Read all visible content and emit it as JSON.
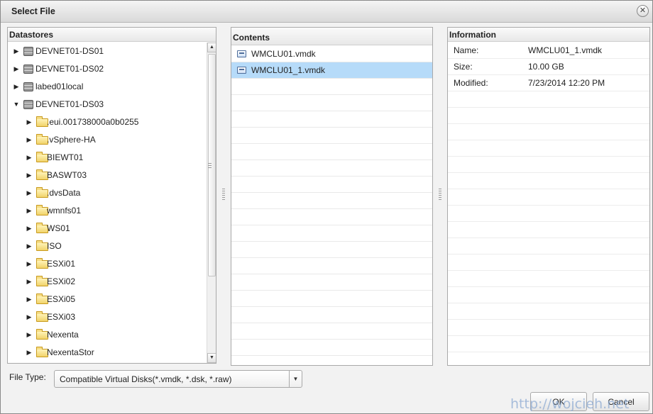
{
  "dialog": {
    "title": "Select File"
  },
  "datastores": {
    "header": "Datastores",
    "items": [
      {
        "label": "DEVNET01-DS01",
        "type": "datastore",
        "level": 0,
        "expanded": false
      },
      {
        "label": "DEVNET01-DS02",
        "type": "datastore",
        "level": 0,
        "expanded": false
      },
      {
        "label": "labed01local",
        "type": "datastore",
        "level": 0,
        "expanded": false
      },
      {
        "label": "DEVNET01-DS03",
        "type": "datastore",
        "level": 0,
        "expanded": true
      },
      {
        "label": ".eui.001738000a0b0255",
        "type": "folder",
        "level": 1,
        "expanded": false
      },
      {
        "label": ".vSphere-HA",
        "type": "folder",
        "level": 1,
        "expanded": false
      },
      {
        "label": "BIEWT01",
        "type": "folder",
        "level": 1,
        "expanded": false
      },
      {
        "label": "BASWT03",
        "type": "folder",
        "level": 1,
        "expanded": false
      },
      {
        "label": ".dvsData",
        "type": "folder",
        "level": 1,
        "expanded": false
      },
      {
        "label": "wmnfs01",
        "type": "folder",
        "level": 1,
        "expanded": false
      },
      {
        "label": "WS01",
        "type": "folder",
        "level": 1,
        "expanded": false
      },
      {
        "label": "ISO",
        "type": "folder",
        "level": 1,
        "expanded": false
      },
      {
        "label": "ESXi01",
        "type": "folder",
        "level": 1,
        "expanded": false
      },
      {
        "label": "ESXi02",
        "type": "folder",
        "level": 1,
        "expanded": false
      },
      {
        "label": "ESXi05",
        "type": "folder",
        "level": 1,
        "expanded": false
      },
      {
        "label": "ESXi03",
        "type": "folder",
        "level": 1,
        "expanded": false
      },
      {
        "label": "Nexenta",
        "type": "folder",
        "level": 1,
        "expanded": false
      },
      {
        "label": "NexentaStor",
        "type": "folder",
        "level": 1,
        "expanded": false
      }
    ]
  },
  "contents": {
    "header": "Contents",
    "files": [
      {
        "name": "WMCLU01.vmdk",
        "selected": false
      },
      {
        "name": "WMCLU01_1.vmdk",
        "selected": true
      }
    ]
  },
  "information": {
    "header": "Information",
    "rows": [
      {
        "key": "Name:",
        "value": "WMCLU01_1.vmdk"
      },
      {
        "key": "Size:",
        "value": "10.00 GB"
      },
      {
        "key": "Modified:",
        "value": "7/23/2014 12:20 PM"
      }
    ]
  },
  "file_type": {
    "label": "File Type:",
    "value": "Compatible Virtual Disks(*.vmdk, *.dsk, *.raw)"
  },
  "buttons": {
    "ok": "OK",
    "cancel": "Cancel"
  },
  "watermark": "http://wojcieh.net",
  "colors": {
    "selection": "#b6dbf9",
    "title_bar": "#e6e6e6"
  }
}
